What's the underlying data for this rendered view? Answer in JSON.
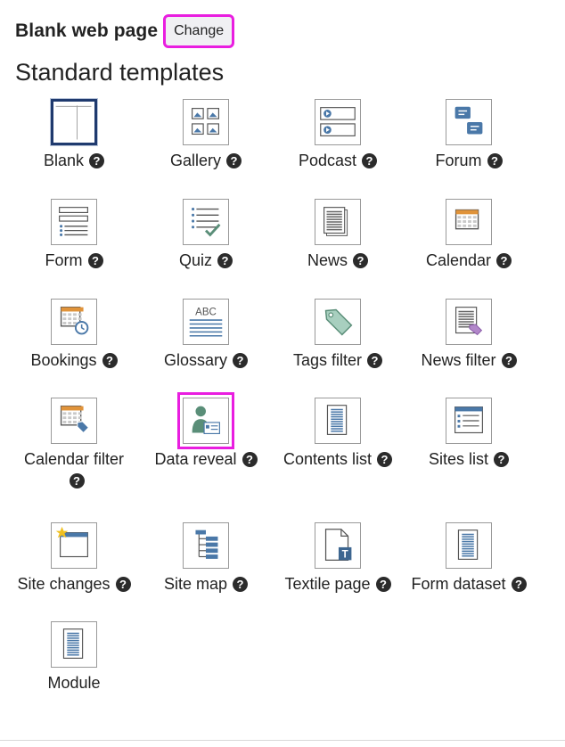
{
  "header": {
    "page_type": "Blank web page",
    "change_label": "Change"
  },
  "section": {
    "title": "Standard templates"
  },
  "help_glyph": "?",
  "colors": {
    "highlight": "#e91ee0",
    "selected_border": "#1f3a6e",
    "icon_blue": "#4a78a8",
    "icon_green": "#5a8e78"
  },
  "templates": [
    {
      "label": "Blank",
      "icon": "blank-template-icon",
      "help": true,
      "selected": true
    },
    {
      "label": "Gallery",
      "icon": "gallery-icon",
      "help": true
    },
    {
      "label": "Podcast",
      "icon": "podcast-icon",
      "help": true
    },
    {
      "label": "Forum",
      "icon": "forum-icon",
      "help": true
    },
    {
      "label": "Form",
      "icon": "form-icon",
      "help": true
    },
    {
      "label": "Quiz",
      "icon": "quiz-icon",
      "help": true
    },
    {
      "label": "News",
      "icon": "news-icon",
      "help": true
    },
    {
      "label": "Calendar",
      "icon": "calendar-icon",
      "help": true
    },
    {
      "label": "Bookings",
      "icon": "bookings-icon",
      "help": true
    },
    {
      "label": "Glossary",
      "icon": "glossary-icon",
      "help": true,
      "icon_text": "ABC"
    },
    {
      "label": "Tags filter",
      "icon": "tag-icon",
      "help": true
    },
    {
      "label": "News filter",
      "icon": "news-filter-icon",
      "help": true
    },
    {
      "label": "Calendar filter",
      "icon": "calendar-filter-icon",
      "help": true
    },
    {
      "label": "Data reveal",
      "icon": "data-reveal-icon",
      "help": true,
      "highlighted": true
    },
    {
      "label": "Contents list",
      "icon": "contents-list-icon",
      "help": true
    },
    {
      "label": "Sites list",
      "icon": "sites-list-icon",
      "help": true
    },
    {
      "label": "Site changes",
      "icon": "site-changes-icon",
      "help": true
    },
    {
      "label": "Site map",
      "icon": "site-map-icon",
      "help": true
    },
    {
      "label": "Textile page",
      "icon": "textile-page-icon",
      "help": true,
      "icon_text": "T"
    },
    {
      "label": "Form dataset",
      "icon": "form-dataset-icon",
      "help": true
    },
    {
      "label": "Module",
      "icon": "module-icon",
      "help": false
    }
  ]
}
